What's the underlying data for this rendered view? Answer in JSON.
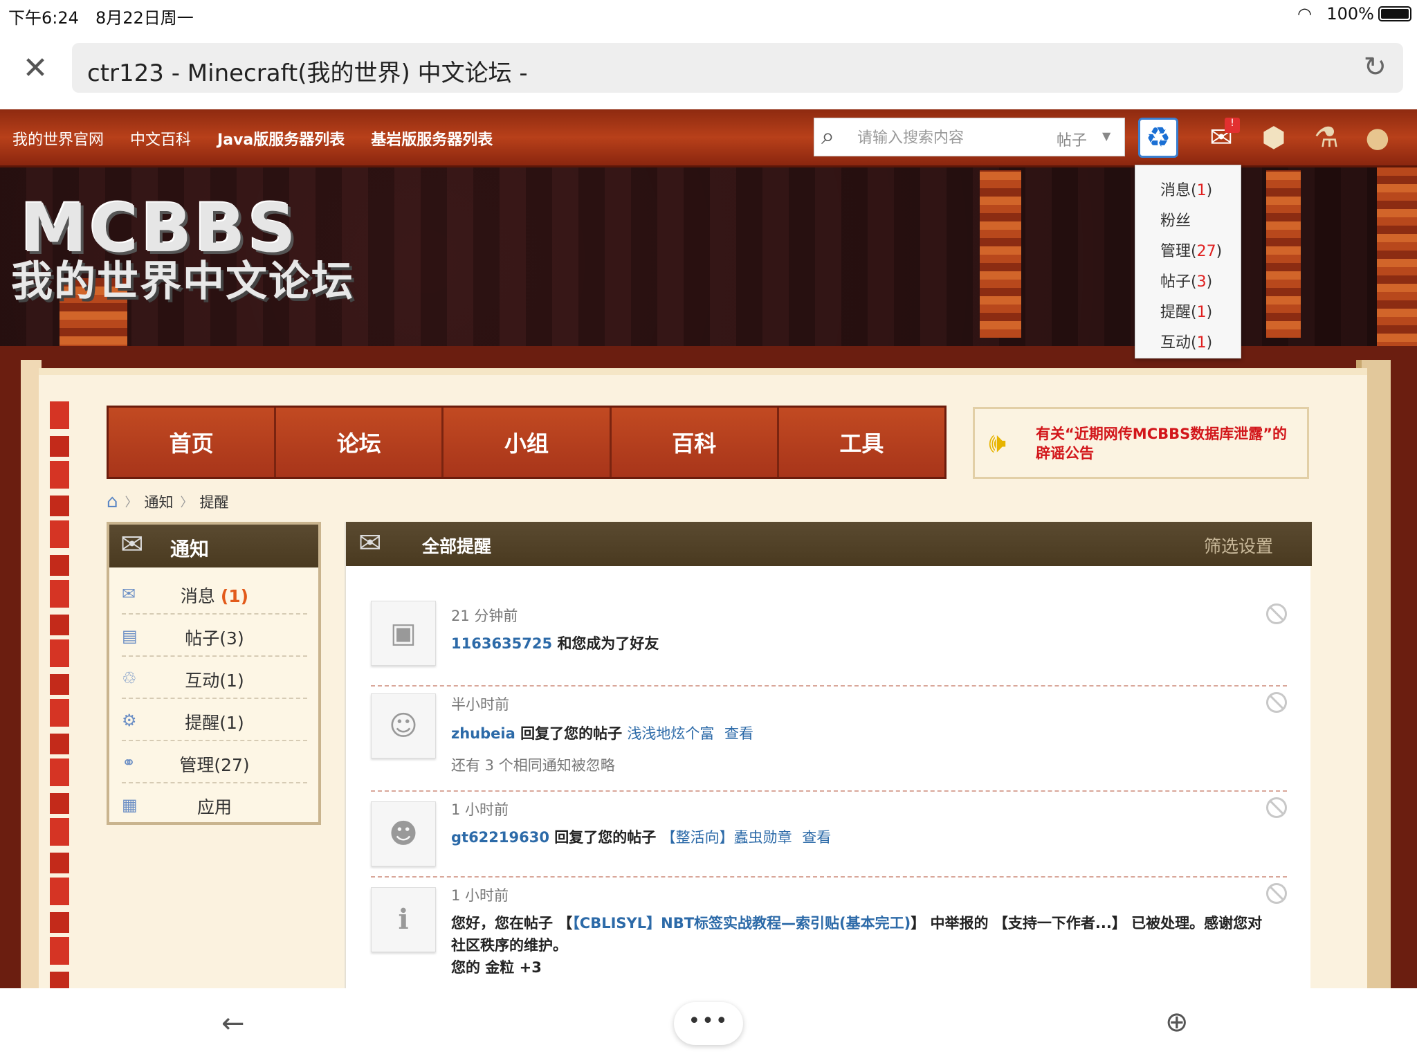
{
  "status": {
    "time": "下午6:24",
    "date": "8月22日周一",
    "battery": "100%"
  },
  "browser": {
    "title": "ctr123 - Minecraft(我的世界) 中文论坛 -"
  },
  "topnav": {
    "links": [
      "我的世界官网",
      "中文百科",
      "Java版服务器列表",
      "基岩版服务器列表"
    ],
    "search_placeholder": "请输入搜索内容",
    "search_type": "帖子"
  },
  "banner": {
    "logo": "MCBBS",
    "logo_sub": "我的世界中文论坛"
  },
  "dropdown": {
    "items": [
      {
        "label": "消息(",
        "count": "1",
        "close": ")"
      },
      {
        "label": "粉丝",
        "count": "",
        "close": ""
      },
      {
        "label": "管理(",
        "count": "27",
        "close": ")"
      },
      {
        "label": "帖子(",
        "count": "3",
        "close": ")"
      },
      {
        "label": "提醒(",
        "count": "1",
        "close": ")"
      },
      {
        "label": "互动(",
        "count": "1",
        "close": ")"
      }
    ]
  },
  "mainnav": [
    "首页",
    "论坛",
    "小组",
    "百科",
    "工具"
  ],
  "notice": "有关“近期网传MCBBS数据库泄露”的辟谣公告",
  "breadcrumb": [
    "通知",
    "提醒"
  ],
  "sidebar": {
    "title": "通知",
    "items": [
      {
        "label": "消息",
        "count": "(1)"
      },
      {
        "label": "帖子(3)"
      },
      {
        "label": "互动(1)"
      },
      {
        "label": "提醒(1)"
      },
      {
        "label": "管理(27)"
      },
      {
        "label": "应用"
      }
    ]
  },
  "content": {
    "title": "全部提醒",
    "filter": "筛选设置",
    "notes": [
      {
        "time": "21 分钟前",
        "user": "1163635725",
        "text": "和您成为了好友"
      },
      {
        "time": "半小时前",
        "user": "zhubeia",
        "text": "回复了您的帖子",
        "thread": "浅浅地炫个富",
        "view": "查看",
        "sub": "还有 3 个相同通知被忽略"
      },
      {
        "time": "1 小时前",
        "user": "gt62219630",
        "text": "回复了您的帖子",
        "thread": "【整活向】蠹虫勋章",
        "view": "查看"
      },
      {
        "time": "1 小时前",
        "line1_a": "您好，您在帖子 【",
        "line1_link": "【CBLISYL】NBT标签实战教程—索引贴(基本完工)",
        "line1_b": "】 中举报的 【支持一下作者...】 已被处理。感谢您对",
        "line2": "社区秩序的维护。",
        "line3": "您的 金粒 +3"
      }
    ]
  }
}
